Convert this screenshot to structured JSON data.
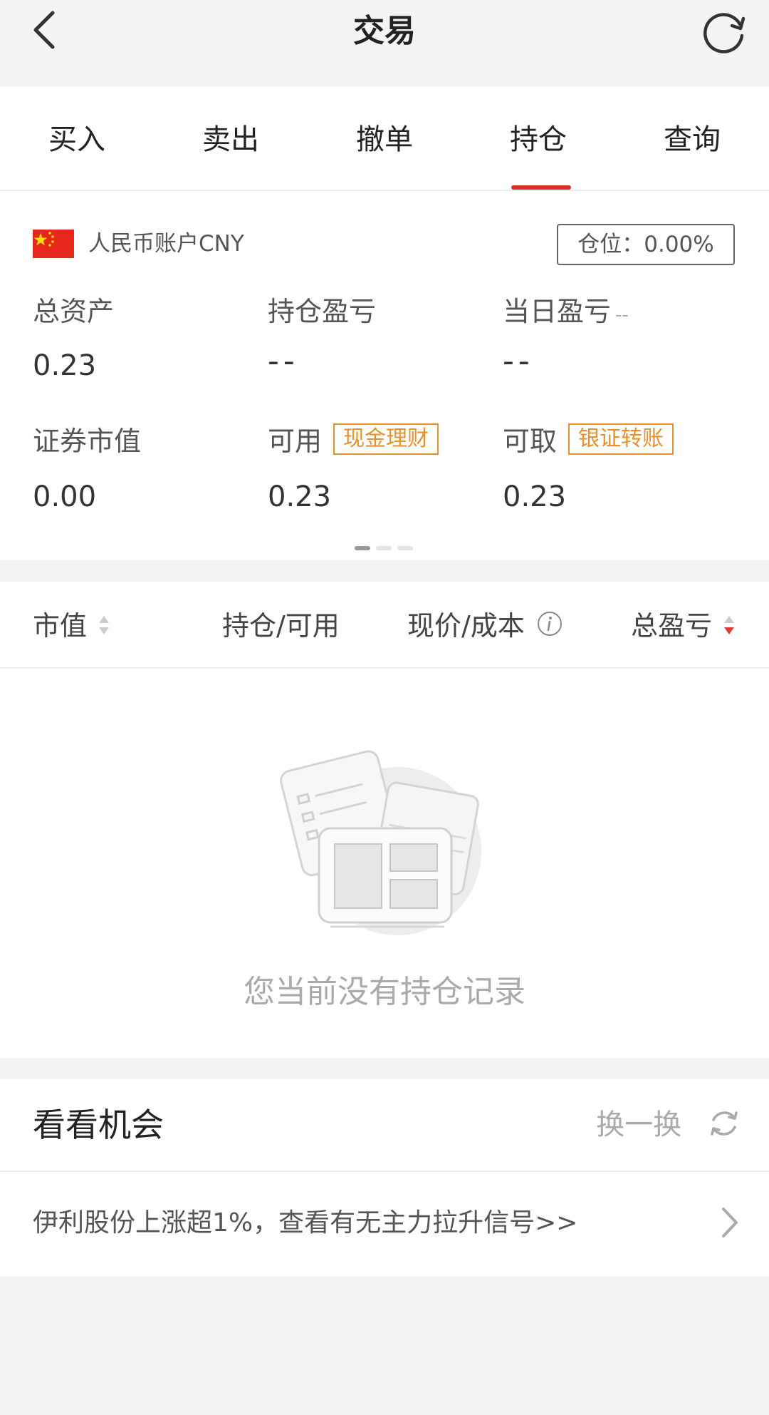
{
  "header": {
    "title": "交易",
    "back_icon": "chevron-left-icon",
    "refresh_icon": "refresh-icon"
  },
  "tabs": [
    {
      "label": "买入",
      "active": false
    },
    {
      "label": "卖出",
      "active": false
    },
    {
      "label": "撤单",
      "active": false
    },
    {
      "label": "持仓",
      "active": true
    },
    {
      "label": "查询",
      "active": false
    }
  ],
  "account": {
    "flag_icon": "china-flag-icon",
    "name": "人民币账户CNY",
    "position_label": "仓位：0.00%",
    "metrics": {
      "total_assets": {
        "label": "总资产",
        "value": "0.23"
      },
      "holding_pnl": {
        "label": "持仓盈亏",
        "value": "--"
      },
      "daily_pnl": {
        "label": "当日盈亏",
        "suffix": "--",
        "value": "--"
      },
      "market_value": {
        "label": "证券市值",
        "value": "0.00"
      },
      "available": {
        "label": "可用",
        "tag": "现金理财",
        "value": "0.23"
      },
      "withdrawable": {
        "label": "可取",
        "tag": "银证转账",
        "value": "0.23"
      }
    },
    "page_indicator": {
      "count": 3,
      "active": 0
    }
  },
  "holdings_table": {
    "columns": [
      "市值",
      "持仓/可用",
      "现价/成本",
      "总盈亏"
    ],
    "empty_text": "您当前没有持仓记录"
  },
  "opportunities": {
    "title": "看看机会",
    "shuffle_label": "换一换",
    "item": "伊利股份上涨超1%，查看有无主力拉升信号>>"
  },
  "colors": {
    "accent": "#d9302d",
    "tag_orange": "#e8912a",
    "background": "#f4f4f6"
  }
}
